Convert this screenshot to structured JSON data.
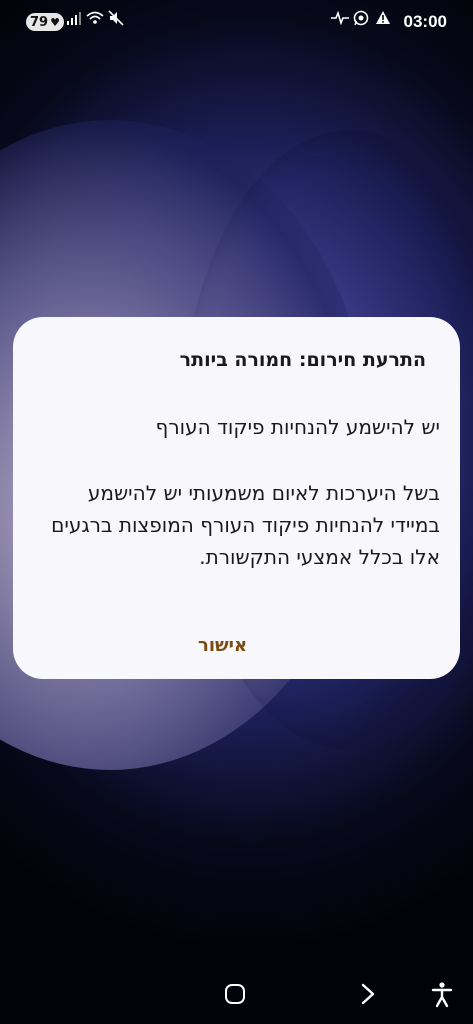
{
  "status_bar": {
    "battery": "79",
    "time": "03:00",
    "icons": [
      "heart-icon",
      "signal-icon",
      "wifi-icon",
      "mute-icon",
      "pulse-icon",
      "whatsapp-icon",
      "warning-icon"
    ]
  },
  "dialog": {
    "title": "התרעת חירום: חמורה ביותר",
    "paragraph1": "יש להישמע להנחיות פיקוד העורף",
    "paragraph2": "בשל היערכות לאיום משמעותי יש להישמע במיידי להנחיות פיקוד העורף המופצות ברגעים אלו בכלל אמצעי התקשורת.",
    "confirm_label": "אישור",
    "button_color": "#7a4a12"
  },
  "nav_bar": {
    "icons": [
      "home-icon",
      "back-chevron-icon",
      "accessibility-icon"
    ]
  }
}
